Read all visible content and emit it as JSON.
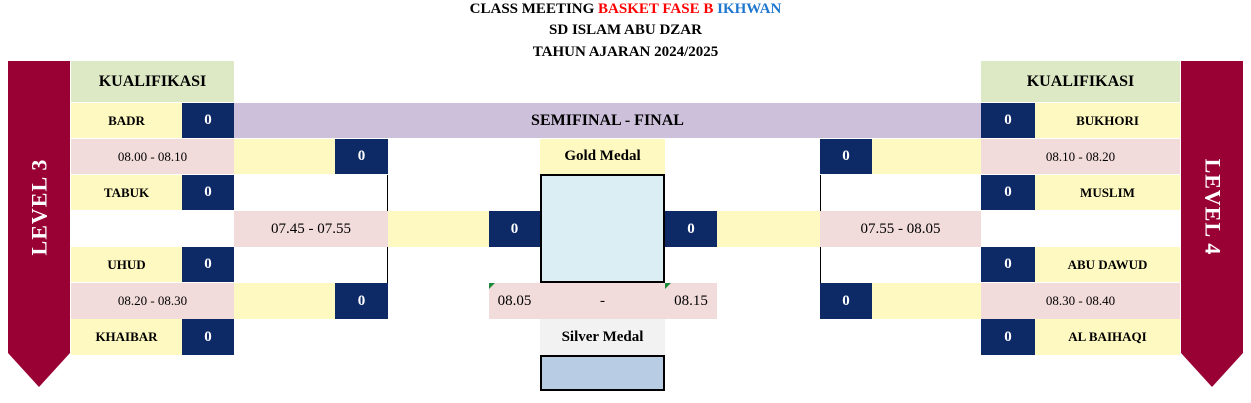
{
  "header": {
    "line1_prefix": "CLASS MEETING",
    "line1_sport": "BASKET FASE B",
    "line1_group": "IKHWAN",
    "line2": "SD ISLAM ABU DZAR",
    "line3": "TAHUN AJARAN 2024/2025",
    "colors": {
      "sport": "#ff0000",
      "group": "#1f77d0"
    }
  },
  "left": {
    "level": "LEVEL 3",
    "qual_label": "KUALIFIKASI",
    "teams": [
      {
        "name": "BADR",
        "score": "0"
      },
      {
        "name": "TABUK",
        "score": "0"
      },
      {
        "name": "UHUD",
        "score": "0"
      },
      {
        "name": "KHAIBAR",
        "score": "0"
      }
    ],
    "match_times": [
      "08.00 - 08.10",
      "08.20 - 08.30"
    ],
    "semi_scores": [
      "0",
      "0"
    ],
    "semi_time": "07.45 - 07.55",
    "final_score": "0"
  },
  "right": {
    "level": "LEVEL 4",
    "qual_label": "KUALIFIKASI",
    "teams": [
      {
        "name": "BUKHORI",
        "score": "0"
      },
      {
        "name": "MUSLIM",
        "score": "0"
      },
      {
        "name": "ABU DAWUD",
        "score": "0"
      },
      {
        "name": "AL BAIHAQI",
        "score": "0"
      }
    ],
    "match_times": [
      "08.10 - 08.20",
      "08.30 - 08.40"
    ],
    "semi_scores": [
      "0",
      "0"
    ],
    "semi_time": "07.55 - 08.05",
    "final_score": "0"
  },
  "center": {
    "stage_label": "SEMIFINAL - FINAL",
    "gold_label": "Gold Medal",
    "silver_label": "Silver Medal",
    "final_time_start": "08.05",
    "final_time_sep": "-",
    "final_time_end": "08.15"
  },
  "colors": {
    "ribbon": "#990033",
    "score_box": "#0e2a66",
    "team_cell": "#fef9c0",
    "qual_label": "#dde8c4",
    "time_cell": "#f2dcdb",
    "stage_bar": "#ccc0da",
    "gold_box": "#daeef3",
    "silver_box": "#b8cce4"
  }
}
